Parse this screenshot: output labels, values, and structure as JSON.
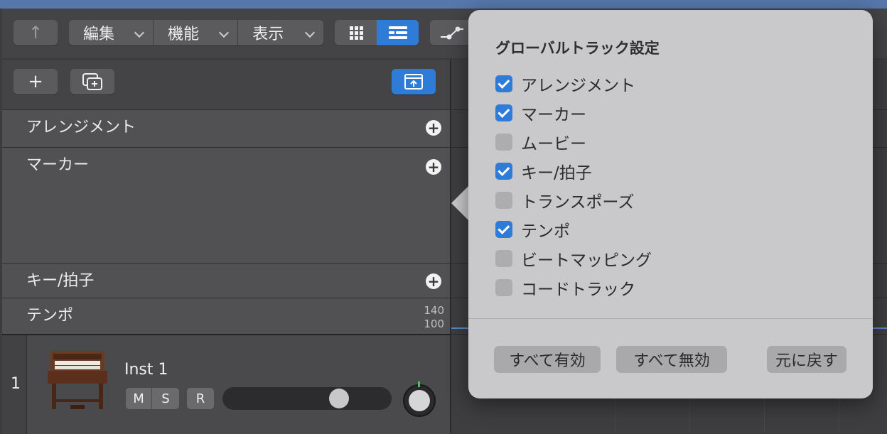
{
  "toolbar": {
    "back_icon": "↑",
    "menus": [
      {
        "label": "編集"
      },
      {
        "label": "機能"
      },
      {
        "label": "表示"
      }
    ]
  },
  "header": {
    "add_icon": "+"
  },
  "global_tracks": [
    {
      "label": "アレンジメント"
    },
    {
      "label": "マーカー"
    },
    {
      "label": "キー/拍子"
    },
    {
      "label": "テンポ",
      "tempo_max": "140",
      "tempo_min": "100"
    }
  ],
  "track": {
    "number": "1",
    "name": "Inst 1",
    "mute_label": "M",
    "solo_label": "S",
    "record_label": "R",
    "volume_level": 0.72
  },
  "popover": {
    "title": "グローバルトラック設定",
    "options": [
      {
        "label": "アレンジメント",
        "checked": true
      },
      {
        "label": "マーカー",
        "checked": true
      },
      {
        "label": "ムービー",
        "checked": false
      },
      {
        "label": "キー/拍子",
        "checked": true
      },
      {
        "label": "トランスポーズ",
        "checked": false
      },
      {
        "label": "テンポ",
        "checked": true
      },
      {
        "label": "ビートマッピング",
        "checked": false
      },
      {
        "label": "コードトラック",
        "checked": false
      }
    ],
    "enable_all_label": "すべて有効",
    "disable_all_label": "すべて無効",
    "revert_label": "元に戻す"
  },
  "colors": {
    "accent": "#2f7bd8",
    "panel": "#515153",
    "popover": "#c9c9cb"
  }
}
